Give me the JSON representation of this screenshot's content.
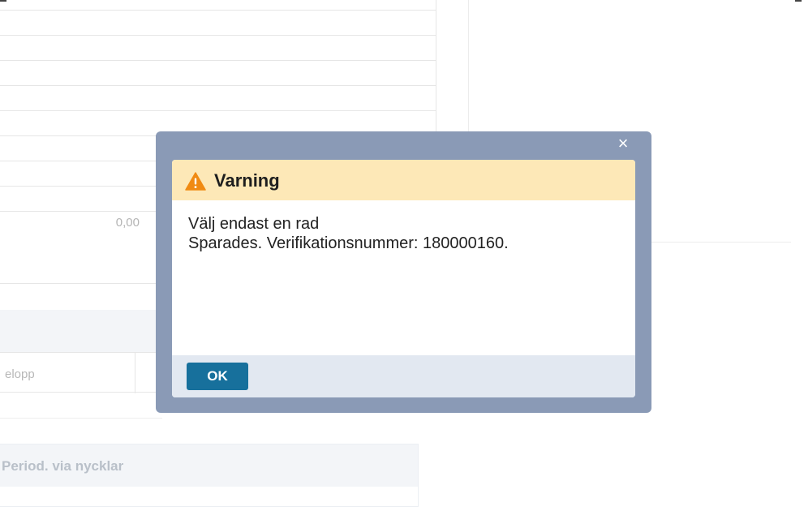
{
  "background": {
    "amount_value": "0,00",
    "column_header_label": "elopp",
    "period_panel_label": "Period. via nycklar"
  },
  "dialog": {
    "close_symbol": "×",
    "title": "Varning",
    "icon": "warning-triangle-icon",
    "messages": [
      "Välj endast en rad",
      "Sparades. Verifikationsnummer: 180000160."
    ],
    "ok_label": "OK",
    "colors": {
      "frame": "#8a9ab6",
      "header": "#fde8b7",
      "footer": "#e2e8f1",
      "ok_button": "#17709c",
      "warning_icon": "#f08a12"
    }
  }
}
